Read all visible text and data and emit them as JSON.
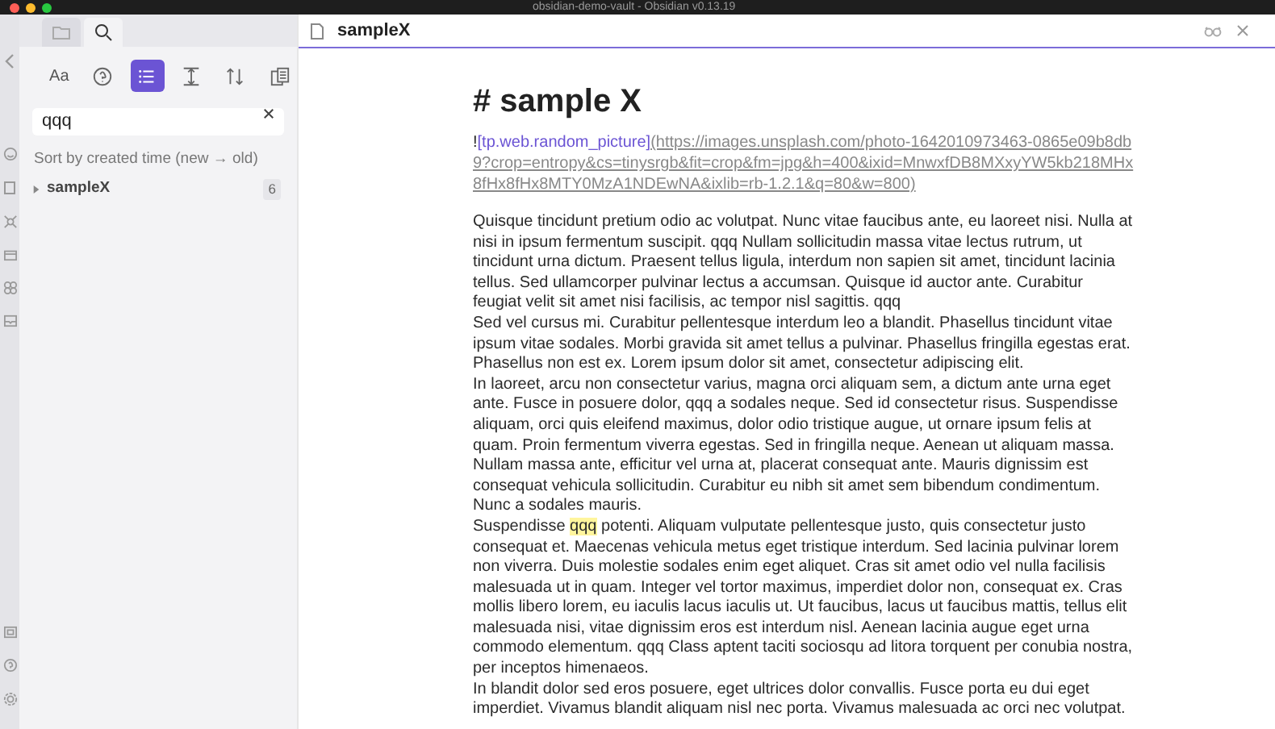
{
  "window": {
    "title": "obsidian-demo-vault - Obsidian v0.13.19"
  },
  "sidebar": {
    "tabs": [
      {
        "kind": "folder",
        "selected": false
      },
      {
        "kind": "search",
        "selected": true
      }
    ],
    "toolbar": [
      {
        "kind": "text",
        "label": "Aa",
        "on": false
      },
      {
        "kind": "help",
        "on": false
      },
      {
        "kind": "list",
        "on": true
      },
      {
        "kind": "collapse",
        "on": false
      },
      {
        "kind": "sort",
        "on": false
      },
      {
        "kind": "copy",
        "on": false
      }
    ],
    "search": {
      "value": "qqq"
    },
    "sort_label": "Sort by created time (new → old)",
    "results": [
      {
        "name": "sampleX",
        "count": "6",
        "expanded": false
      }
    ]
  },
  "editor": {
    "tab_title": "sampleX",
    "heading": "# sample X",
    "link": {
      "bang": "!",
      "text": "[tp.web.random_picture]",
      "url": "(https://images.unsplash.com/photo-1642010973463-0865e09b8db9?crop=entropy&cs=tinysrgb&fit=crop&fm=jpg&h=400&ixid=MnwxfDB8MXxyYW5kb218MHx8fHx8fHx8MTY0MzA1NDEwNA&ixlib=rb-1.2.1&q=80&w=800)"
    },
    "paragraphs": [
      [
        {
          "text": "Quisque tincidunt pretium odio ac volutpat. Nunc vitae faucibus ante, eu laoreet nisi. Nulla at nisi in ipsum fermentum suscipit. qqq Nullam sollicitudin massa vitae lectus rutrum, ut tincidunt urna dictum. Praesent tellus ligula, interdum non sapien sit amet, tincidunt lacinia tellus. Sed ullamcorper pulvinar lectus a accumsan. Quisque id auctor ante. Curabitur feugiat velit sit amet nisi facilisis, ac tempor nisl sagittis. qqq",
          "highlighted": false
        }
      ],
      [
        {
          "text": "Sed vel cursus mi. Curabitur pellentesque interdum leo a blandit. Phasellus tincidunt vitae ipsum vitae sodales. Morbi gravida sit amet tellus a pulvinar. Phasellus fringilla egestas erat. Phasellus non est ex. Lorem ipsum dolor sit amet, consectetur adipiscing elit.",
          "highlighted": false
        }
      ],
      [
        {
          "text": "In laoreet, arcu non consectetur varius, magna orci aliquam sem, a dictum ante urna eget ante. Fusce in posuere dolor,  qqq a sodales neque. Sed id consectetur risus. Suspendisse aliquam, orci quis eleifend maximus, dolor odio tristique augue, ut ornare ipsum felis at quam. Proin fermentum viverra egestas. Sed in fringilla neque. Aenean ut aliquam massa. Nullam massa ante, efficitur vel urna at, placerat consequat ante. Mauris dignissim est consequat vehicula sollicitudin. Curabitur eu nibh sit amet sem bibendum condimentum. Nunc a sodales mauris.",
          "highlighted": false
        }
      ],
      [
        {
          "text": "Suspendisse ",
          "highlighted": false
        },
        {
          "text": "qqq",
          "highlighted": true
        },
        {
          "text": " potenti. Aliquam vulputate pellentesque justo, quis consectetur justo consequat et. Maecenas vehicula metus eget tristique interdum. Sed lacinia pulvinar lorem non viverra. Duis molestie sodales enim eget aliquet. Cras sit amet odio vel nulla facilisis malesuada ut in quam. Integer vel tortor maximus, imperdiet dolor non, consequat ex. Cras mollis libero lorem, eu iaculis lacus iaculis ut. Ut faucibus, lacus ut faucibus mattis, tellus elit malesuada nisi, vitae dignissim eros est interdum nisl. Aenean lacinia augue eget urna commodo elementum. qqq Class aptent taciti sociosqu ad litora torquent per conubia nostra, per inceptos himenaeos.",
          "highlighted": false
        }
      ],
      [
        {
          "text": "In blandit dolor sed eros posuere, eget ultrices dolor convallis. Fusce porta eu dui eget imperdiet. Vivamus blandit aliquam nisl nec porta. Vivamus malesuada ac orci nec volutpat.",
          "highlighted": false
        }
      ]
    ]
  }
}
